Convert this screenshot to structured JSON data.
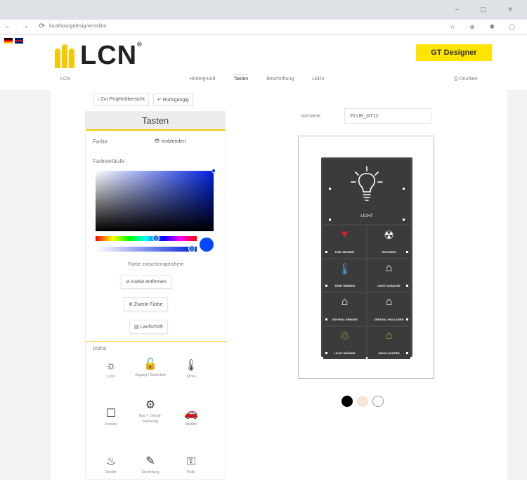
{
  "browser": {
    "url": "localhost/gtdesigner/editor",
    "nav_glyphs": "← → ⟳",
    "window_glyphs": "– ▢ ✕",
    "toolbar_glyphs": "☆ ⊕ ✱ ▢"
  },
  "header": {
    "logo_text": "LCN",
    "logo_reg": "®",
    "designer_button": "GT Designer",
    "project_label": "LCN",
    "tabs": [
      "Hintergrund",
      "Tasten",
      "Beschriftung",
      "LEDs"
    ],
    "active_tab": "Tasten",
    "print_label": "⎙ Drucken"
  },
  "left_panel": {
    "back_button": "‹ Zur Projektübersicht",
    "undo_button": "↶ Rückgängig",
    "title": "Tasten",
    "farbe_label": "Farbe",
    "einblenden_label": "👁 einblenden",
    "farbverlauf_label": "Farbverläufe",
    "save_hint": "Farbe zwischenspeichern",
    "remove_color": "⊘ Farbe entfernen",
    "second_color": "⊕ Zweite Farbe",
    "swatch_color": "#0047ff",
    "hue_position": 0.6,
    "alpha_position": 0.95,
    "icons_title": "Icons",
    "icons": [
      {
        "glyph": "☼",
        "label": "Licht"
      },
      {
        "glyph": "🔓",
        "label": "Zugang / Sicherheit"
      },
      {
        "glyph": "🌡",
        "label": "Klima"
      },
      {
        "glyph": "☐",
        "label": "Fenster"
      },
      {
        "glyph": "⚙",
        "label": "Bad + Zentral-steuerung"
      },
      {
        "glyph": "🚗",
        "label": "Medien"
      },
      {
        "glyph": "♨",
        "label": "Sonder"
      },
      {
        "glyph": "✎",
        "label": "Einrichtung"
      },
      {
        "glyph": "⚿",
        "label": "Rollo"
      }
    ]
  },
  "editor": {
    "name_label": "Vorname",
    "name_value": "FLUR_GT12",
    "big_key_label": "LICHT",
    "keys": [
      {
        "glyph": "♥",
        "label": "PINK SENDEN",
        "color": "#d0212a"
      },
      {
        "glyph": "☢",
        "label": "SICHERES",
        "color": "#ffffff"
      },
      {
        "glyph": "🌡",
        "label": "TEMP SENDEN",
        "color": "#4a9fe0"
      },
      {
        "glyph": "⌂",
        "label": "LICHT ZUHAUSE",
        "color": "#ffffff"
      },
      {
        "glyph": "⌂",
        "label": "ZENTRAL SENDEN",
        "color": "#ffffff"
      },
      {
        "glyph": "⌂",
        "label": "ZENTRAL ROLLADEN",
        "color": "#ffffff"
      },
      {
        "glyph": "♲",
        "label": "LICHT GRÜNES",
        "color": "#7bc043"
      },
      {
        "glyph": "⌂",
        "label": "GRÜN LICHTER",
        "color": "#7bc043"
      }
    ],
    "background_colors": [
      "#000000",
      "#f4e6d6",
      "#ffffff"
    ]
  }
}
